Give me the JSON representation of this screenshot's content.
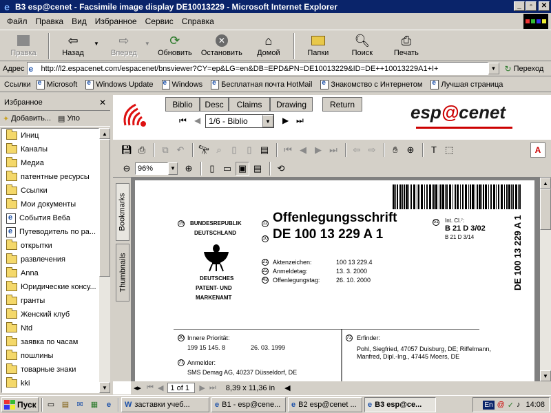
{
  "window": {
    "title": "B3 esp@cenet - Facsimile image display DE10013229 - Microsoft Internet Explorer"
  },
  "menu": {
    "items": [
      "Файл",
      "Правка",
      "Вид",
      "Избранное",
      "Сервис",
      "Справка"
    ]
  },
  "toolbar": {
    "back": "Правка",
    "back2": "Назад",
    "forward": "Вперед",
    "refresh": "Обновить",
    "stop": "Остановить",
    "home": "Домой",
    "folders": "Папки",
    "search": "Поиск",
    "print": "Печать"
  },
  "address": {
    "label": "Адрес",
    "url": "http://l2.espacenet.com/espacenet/bnsviewer?CY=ep&LG=en&DB=EPD&PN=DE10013229&ID=DE++10013229A1+I+",
    "go": "Переход"
  },
  "links": {
    "label": "Ссылки",
    "items": [
      "Microsoft",
      "Windows Update",
      "Windows",
      "Бесплатная почта HotMail",
      "Знакомство с Интернетом",
      "Лучшая страница"
    ]
  },
  "favorites": {
    "title": "Избранное",
    "add": "Добавить...",
    "organize": "Упо",
    "items": [
      {
        "label": "Иниц",
        "type": "folder"
      },
      {
        "label": "Каналы",
        "type": "folder"
      },
      {
        "label": "Медиа",
        "type": "folder"
      },
      {
        "label": "патентные ресурсы",
        "type": "folder"
      },
      {
        "label": "Ссылки",
        "type": "folder"
      },
      {
        "label": "Мои документы",
        "type": "folder"
      },
      {
        "label": "События Веба",
        "type": "page"
      },
      {
        "label": "Путеводитель по ра...",
        "type": "page"
      },
      {
        "label": "открытки",
        "type": "folder"
      },
      {
        "label": "развлечения",
        "type": "folder"
      },
      {
        "label": "Anna",
        "type": "folder"
      },
      {
        "label": "Юридические консу...",
        "type": "folder"
      },
      {
        "label": "гранты",
        "type": "folder"
      },
      {
        "label": "Женский клуб",
        "type": "folder"
      },
      {
        "label": "Ntd",
        "type": "folder"
      },
      {
        "label": "заявка по часам",
        "type": "folder"
      },
      {
        "label": "пошлины",
        "type": "folder"
      },
      {
        "label": "товарные знаки",
        "type": "folder"
      },
      {
        "label": "kki",
        "type": "folder"
      }
    ]
  },
  "viewer": {
    "tabs": [
      "Biblio",
      "Desc",
      "Claims",
      "Drawing",
      "Return"
    ],
    "brand_a": "esp",
    "brand_b": "@",
    "brand_c": "cenet",
    "page_select": "1/6 - Biblio",
    "zoom": "96%",
    "side_tabs": [
      "Bookmarks",
      "Thumbnails"
    ],
    "page_info": "1 of 1",
    "page_size": "8,39 x 11,36 in",
    "adobe": "Adobe"
  },
  "document": {
    "n19": "19",
    "n12": "12",
    "n10": "10",
    "n51": "51",
    "n21": "21",
    "n22": "22",
    "n43": "43",
    "n30": "30",
    "n71": "71",
    "n72": "72",
    "country1": "BUNDESREPUBLIK",
    "country2": "DEUTSCHLAND",
    "office1": "DEUTSCHES",
    "office2": "PATENT- UND",
    "office3": "MARKENAMT",
    "doctype": "Offenlegungsschrift",
    "docnum": "DE  100 13 229  A 1",
    "intcl_label": "Int. Cl.⁷:",
    "intcl1": "B 21 D 3/02",
    "intcl2": "B 21 D 3/14",
    "f21": "Aktenzeichen:",
    "v21": "100 13 229.4",
    "f22": "Anmeldetag:",
    "v22": "13.  3. 2000",
    "f43": "Offenlegungstag:",
    "v43": "26. 10. 2000",
    "side_num": "DE 100 13 229 A 1",
    "prio_label": "Innere Priorität:",
    "prio_num": "199 15 145. 8",
    "prio_date": "26. 03. 1999",
    "appl_label": "Anmelder:",
    "appl": "SMS Demag AG, 40237 Düsseldorf, DE",
    "inv_label": "Erfinder:",
    "inv1": "Pohl, Siegfried, 47057 Duisburg, DE; Riffelmann,",
    "inv2": "Manfred, Dipl.-Ing., 47445 Moers, DE"
  },
  "taskbar": {
    "start": "Пуск",
    "tasks": [
      "заставки учеб...",
      "B1 - esp@cene...",
      "B2 esp@cenet ...",
      "B3 esp@ce..."
    ],
    "lang": "En",
    "clock": "14:08"
  }
}
